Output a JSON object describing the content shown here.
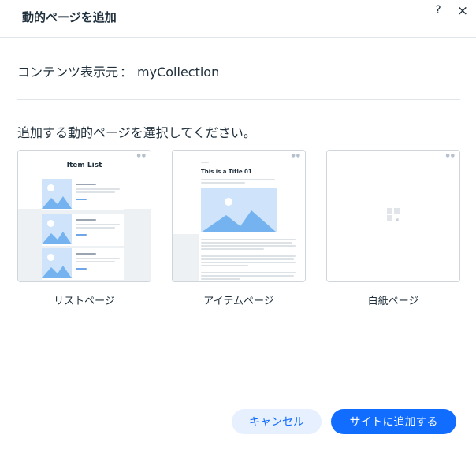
{
  "dialog": {
    "title": "動的ページを追加",
    "help_label": "?",
    "close_label": "×"
  },
  "source": {
    "label": "コンテンツ表示元",
    "separator": "：",
    "value": "myCollection"
  },
  "prompt": "追加する動的ページを選択してください。",
  "cards": [
    {
      "label": "リストページ",
      "preview_title": "Item List"
    },
    {
      "label": "アイテムページ",
      "preview_title": "This is a Title 01"
    },
    {
      "label": "白紙ページ"
    }
  ],
  "buttons": {
    "cancel": "キャンセル",
    "add": "サイトに追加する"
  },
  "colors": {
    "accent": "#116dff",
    "accent_light": "#e7f0ff",
    "text": "#20303c",
    "divider": "#dfe5eb",
    "thumbnail": "#cfe4fb",
    "mountain": "#74b2f0"
  }
}
